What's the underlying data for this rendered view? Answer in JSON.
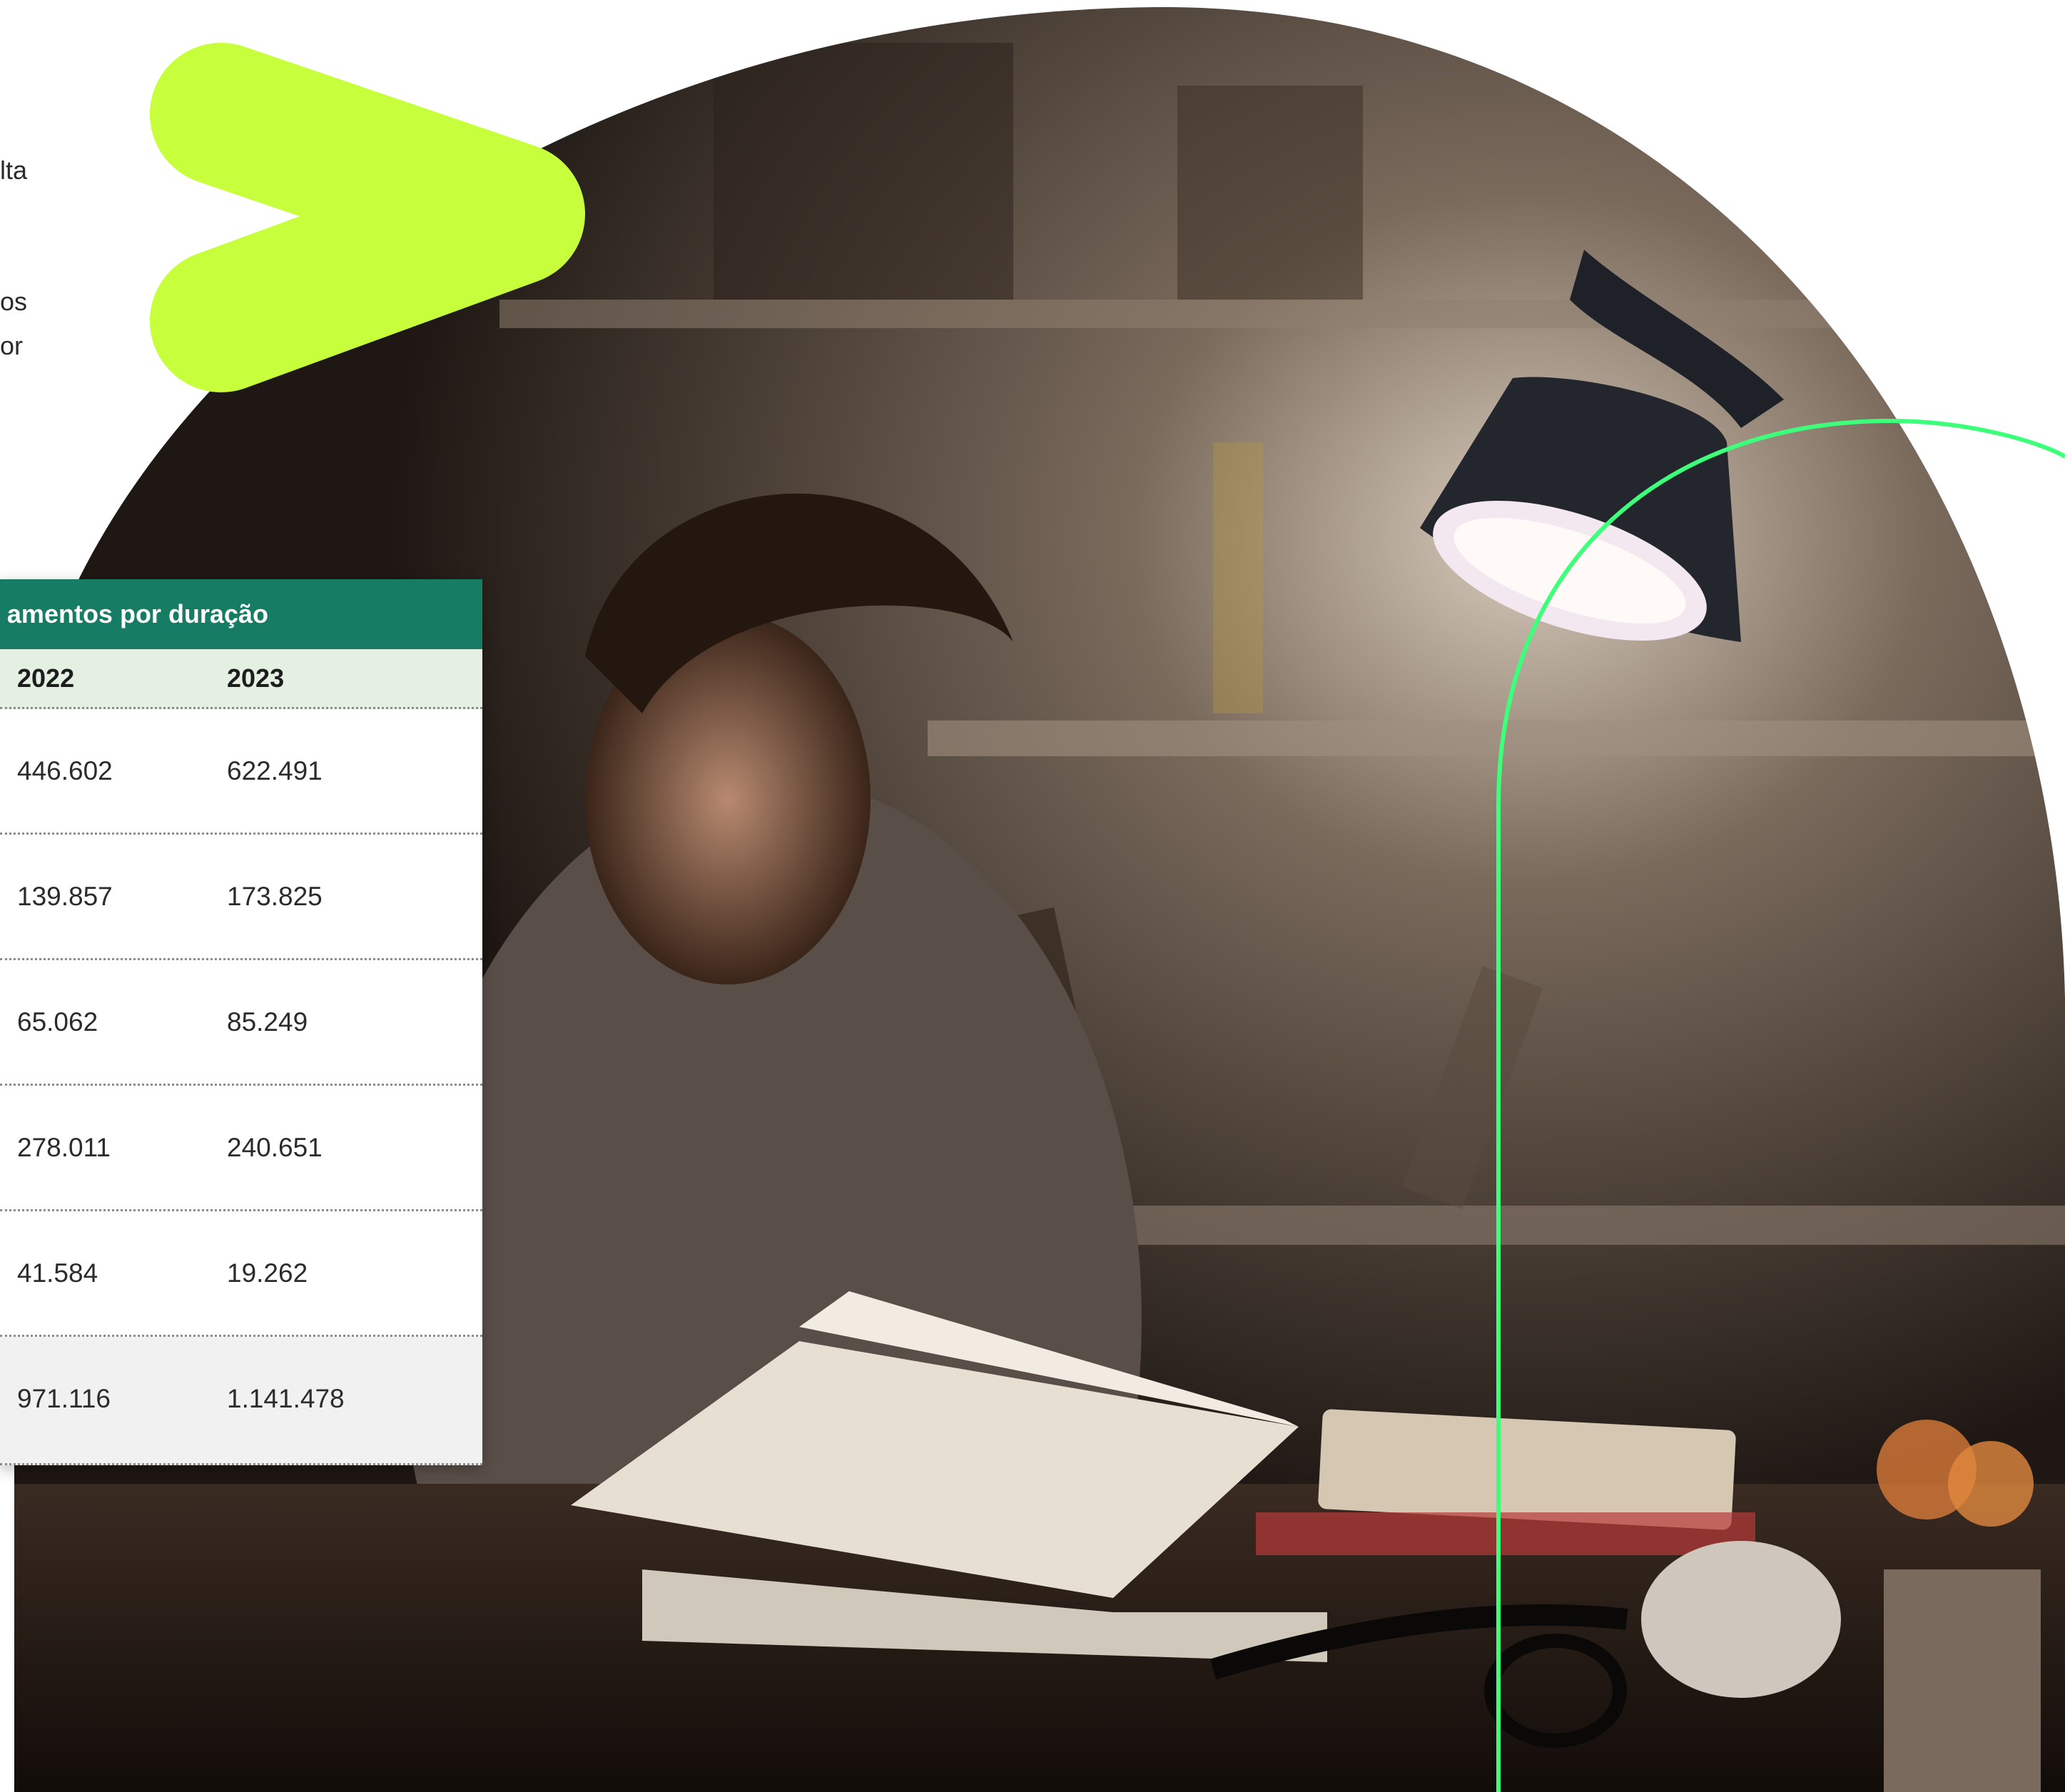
{
  "left_text_fragments": {
    "line1": "lta",
    "line2": "os",
    "line3": "or"
  },
  "table": {
    "title": "amentos por duração",
    "columns": [
      "2022",
      "2023"
    ],
    "rows": [
      [
        "446.602",
        "622.491"
      ],
      [
        "139.857",
        "173.825"
      ],
      [
        "65.062",
        "85.249"
      ],
      [
        "278.011",
        "240.651"
      ],
      [
        "41.584",
        "19.262"
      ]
    ],
    "total": [
      "971.116",
      "1.141.478"
    ]
  },
  "colors": {
    "header_green": "#167d64",
    "subheader_green": "#e4f1e2",
    "chevron_lime": "#c8ff3c",
    "accent_line": "#3dff7a"
  }
}
